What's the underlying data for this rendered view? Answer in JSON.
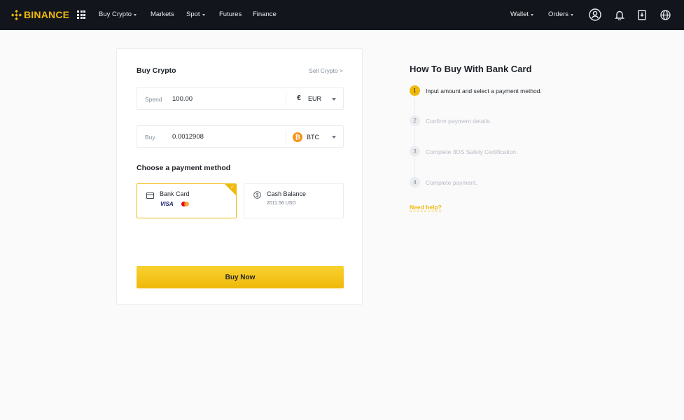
{
  "brand": {
    "name": "BINANCE",
    "color": "#f0b90b"
  },
  "nav": {
    "left": [
      {
        "label": "Buy Crypto",
        "caret": true
      },
      {
        "label": "Markets",
        "caret": false
      },
      {
        "label": "Spot",
        "caret": true
      },
      {
        "label": "Futures",
        "caret": false
      },
      {
        "label": "Finance",
        "caret": false
      }
    ],
    "right": [
      {
        "label": "Wallet",
        "caret": true
      },
      {
        "label": "Orders",
        "caret": true
      }
    ],
    "icons": [
      "user-icon",
      "bell-icon",
      "download-icon",
      "globe-icon"
    ]
  },
  "buy_card": {
    "title": "Buy Crypto",
    "sell_link": "Sell Crypto >",
    "spend": {
      "label": "Spend",
      "value": "100.00",
      "currency": "EUR",
      "currency_symbol": "€"
    },
    "buy": {
      "label": "Buy",
      "value": "0.0012908",
      "currency": "BTC",
      "currency_symbol": "₿"
    },
    "payment_title": "Choose a payment method",
    "methods": [
      {
        "name": "Bank Card",
        "brands": [
          "VISA",
          "mastercard"
        ],
        "selected": true
      },
      {
        "name": "Cash Balance",
        "sub": "2011.56 USD",
        "selected": false
      }
    ],
    "buy_button": "Buy Now"
  },
  "guide": {
    "title": "How To Buy With Bank Card",
    "steps": [
      {
        "num": "1",
        "text": "Input amount and select a payment method.",
        "active": true
      },
      {
        "num": "2",
        "text": "Confirm payment details.",
        "active": false
      },
      {
        "num": "3",
        "text": "Complete 3DS Safety Certification.",
        "active": false
      },
      {
        "num": "4",
        "text": "Complete payment.",
        "active": false
      }
    ],
    "help": "Need help?"
  }
}
